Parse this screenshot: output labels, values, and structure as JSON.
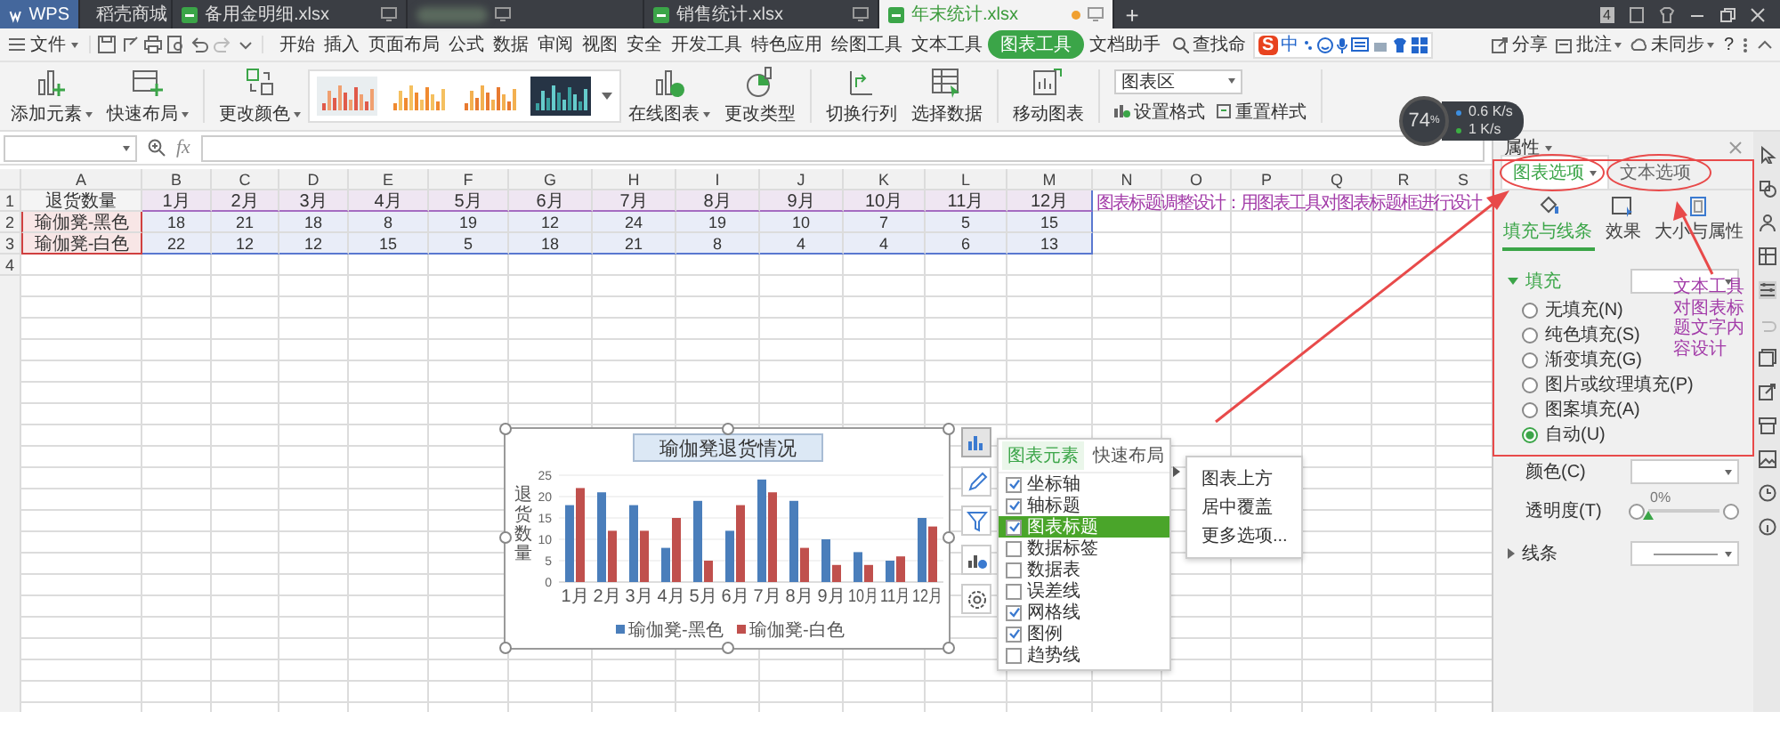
{
  "tabs": [
    {
      "label": "WPS",
      "kind": "home",
      "selected": false,
      "modified": false
    },
    {
      "label": "稻壳商城",
      "kind": "store",
      "selected": false,
      "modified": false
    },
    {
      "label": "备用金明细.xlsx",
      "kind": "sheet",
      "selected": false,
      "modified": false
    },
    {
      "kind": "blurred",
      "selected": false,
      "modified": false
    },
    {
      "label": "销售统计.xlsx",
      "kind": "sheet",
      "selected": false,
      "modified": false
    },
    {
      "label": "年末统计.xlsx",
      "kind": "sheet",
      "selected": true,
      "modified": true
    }
  ],
  "new_tab": "+",
  "window_count": "4",
  "menu": {
    "file": "文件",
    "items": [
      {
        "label": "开始",
        "selected": false
      },
      {
        "label": "插入",
        "selected": false
      },
      {
        "label": "页面布局",
        "selected": false
      },
      {
        "label": "公式",
        "selected": false
      },
      {
        "label": "数据",
        "selected": false
      },
      {
        "label": "审阅",
        "selected": false
      },
      {
        "label": "视图",
        "selected": false
      },
      {
        "label": "安全",
        "selected": false
      },
      {
        "label": "开发工具",
        "selected": false
      },
      {
        "label": "特色应用",
        "selected": false
      },
      {
        "label": "绘图工具",
        "selected": false
      },
      {
        "label": "文本工具",
        "selected": false
      },
      {
        "label": "图表工具",
        "selected": true
      },
      {
        "label": "文档助手",
        "selected": false
      }
    ],
    "search": "查找命",
    "actions": [
      "分享",
      "批注",
      "未同步"
    ],
    "help": "?"
  },
  "ime": {
    "logo": "S",
    "mode": "中"
  },
  "ribbon": {
    "buttons": [
      {
        "label": "添加元素",
        "dropdown": true
      },
      {
        "label": "快速布局",
        "dropdown": true
      },
      {
        "label": "更改颜色",
        "dropdown": true
      }
    ],
    "buttons2": [
      {
        "label": "在线图表",
        "dropdown": true
      },
      {
        "label": "更改类型",
        "dropdown": false
      },
      {
        "label": "切换行列",
        "dropdown": false
      },
      {
        "label": "选择数据",
        "dropdown": false
      },
      {
        "label": "移动图表",
        "dropdown": false
      }
    ],
    "element_select": "图表区",
    "format_buttons": [
      "设置格式",
      "重置样式"
    ]
  },
  "formula_bar": {
    "fx": "fx"
  },
  "sheet": {
    "columns": [
      "A",
      "B",
      "C",
      "D",
      "E",
      "F",
      "G",
      "H",
      "I",
      "J",
      "K",
      "L",
      "M",
      "N",
      "O",
      "P",
      "Q",
      "R",
      "S"
    ],
    "rows": [
      {
        "number": "1",
        "cells": [
          "退货数量",
          "1月",
          "2月",
          "3月",
          "4月",
          "5月",
          "6月",
          "7月",
          "8月",
          "9月",
          "10月",
          "11月",
          "12月"
        ]
      },
      {
        "number": "2",
        "cells": [
          "瑜伽凳-黑色",
          "18",
          "21",
          "18",
          "8",
          "19",
          "12",
          "24",
          "19",
          "10",
          "7",
          "5",
          "15"
        ]
      },
      {
        "number": "3",
        "cells": [
          "瑜伽凳-白色",
          "22",
          "12",
          "12",
          "15",
          "5",
          "18",
          "21",
          "8",
          "4",
          "4",
          "6",
          "13"
        ]
      },
      {
        "number": "4",
        "cells": []
      }
    ]
  },
  "annotations": [
    "图表标题调整设计：用图表工具对图表标题框进行设计",
    "文本工具对图表标题文字内容设计"
  ],
  "chart": {
    "chart_data": {
      "type": "bar",
      "title": "瑜伽凳退货情况",
      "ylabel": "退货数量",
      "categories": [
        "1月",
        "2月",
        "3月",
        "4月",
        "5月",
        "6月",
        "7月",
        "8月",
        "9月",
        "10月",
        "11月",
        "12月"
      ],
      "series": [
        {
          "name": "瑜伽凳-黑色",
          "color": "#4a7ebb",
          "values": [
            18,
            21,
            18,
            8,
            19,
            12,
            24,
            19,
            10,
            7,
            5,
            15
          ]
        },
        {
          "name": "瑜伽凳-白色",
          "color": "#c0504d",
          "values": [
            22,
            12,
            12,
            15,
            5,
            18,
            21,
            8,
            4,
            4,
            6,
            13
          ]
        }
      ],
      "ylim": [
        0,
        25
      ],
      "yticks": [
        {
          "value": 0,
          "label": "0"
        },
        {
          "value": 5,
          "label": "5"
        },
        {
          "value": 10,
          "label": "10"
        },
        {
          "value": 15,
          "label": "15"
        },
        {
          "value": 20,
          "label": "20"
        },
        {
          "value": 25,
          "label": "25"
        }
      ],
      "grid": true,
      "legend": true
    }
  },
  "chart_tools": [
    {
      "selected": true
    },
    {
      "selected": false
    },
    {
      "selected": false
    },
    {
      "selected": false
    },
    {
      "selected": false
    }
  ],
  "chart_popup": {
    "tabs": [
      {
        "label": "图表元素",
        "selected": true
      },
      {
        "label": "快速布局",
        "selected": false
      }
    ],
    "items": [
      {
        "label": "坐标轴",
        "checked": true,
        "selected": false
      },
      {
        "label": "轴标题",
        "checked": true,
        "selected": false
      },
      {
        "label": "图表标题",
        "checked": true,
        "selected": true
      },
      {
        "label": "数据标签",
        "checked": false,
        "selected": false
      },
      {
        "label": "数据表",
        "checked": false,
        "selected": false
      },
      {
        "label": "误差线",
        "checked": false,
        "selected": false
      },
      {
        "label": "网格线",
        "checked": true,
        "selected": false
      },
      {
        "label": "图例",
        "checked": true,
        "selected": false
      },
      {
        "label": "趋势线",
        "checked": false,
        "selected": false
      }
    ],
    "submenu": [
      "图表上方",
      "居中覆盖",
      "更多选项..."
    ]
  },
  "gauge": {
    "value": "74",
    "unit": "%",
    "speeds": [
      {
        "value": "0.6",
        "unit": "K/s",
        "color": "#3d8fe0"
      },
      {
        "value": "1",
        "unit": "K/s",
        "color": "#3cb043"
      }
    ]
  },
  "panel": {
    "title": "属性",
    "tabs": [
      {
        "label": "图表选项",
        "selected": true,
        "dropdown": true
      },
      {
        "label": "文本选项",
        "selected": false,
        "dropdown": false
      }
    ],
    "subtabs": [
      {
        "label": "填充与线条",
        "selected": true
      },
      {
        "label": "效果",
        "selected": false
      },
      {
        "label": "大小与属性",
        "selected": false
      }
    ],
    "fill": {
      "label": "填充",
      "expanded": true,
      "options": [
        {
          "label": "无填充(N)",
          "selected": false
        },
        {
          "label": "纯色填充(S)",
          "selected": false
        },
        {
          "label": "渐变填充(G)",
          "selected": false
        },
        {
          "label": "图片或纹理填充(P)",
          "selected": false
        },
        {
          "label": "图案填充(A)",
          "selected": false
        },
        {
          "label": "自动(U)",
          "selected": true
        }
      ]
    },
    "color": {
      "label": "颜色(C)"
    },
    "transparency": {
      "label": "透明度(T)",
      "level": 0,
      "reading": "0%"
    },
    "line": {
      "label": "线条",
      "expanded": false
    }
  }
}
